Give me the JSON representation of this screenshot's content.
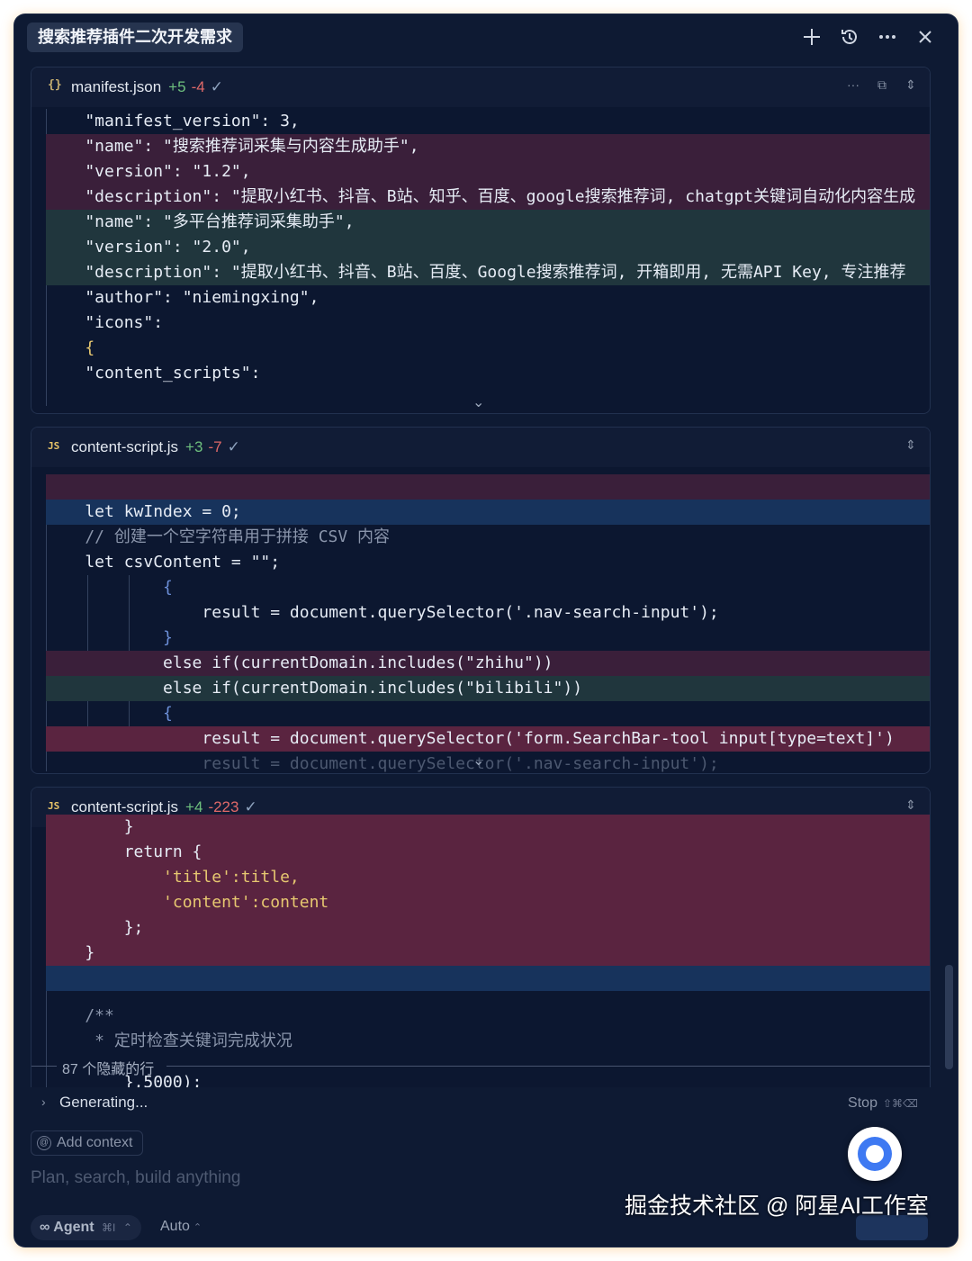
{
  "header": {
    "title": "搜索推荐插件二次开发需求",
    "icons": [
      "plus-icon",
      "history-icon",
      "more-icon",
      "close-icon"
    ]
  },
  "panels": [
    {
      "file_icon": "{}",
      "file_name": "manifest.json",
      "additions": "+5",
      "deletions": "-4",
      "check": "✓",
      "lines": [
        "    \"manifest_version\": 3,",
        "    \"name\": \"搜索推荐词采集与内容生成助手\",",
        "    \"version\": \"1.2\",",
        "    \"description\": \"提取小红书、抖音、B站、知乎、百度、google搜索推荐词, chatgpt关键词自动化内容生成",
        "    \"name\": \"多平台推荐词采集助手\",",
        "    \"version\": \"2.0\",",
        "    \"description\": \"提取小红书、抖音、B站、百度、Google搜索推荐词, 开箱即用, 无需API Key, 专注推荐",
        "    \"author\": \"niemingxing\",",
        "    \"icons\":",
        "    {",
        "    \"content_scripts\":"
      ]
    },
    {
      "file_icon": "JS",
      "file_name": "content-script.js",
      "additions": "+3",
      "deletions": "-7",
      "check": "✓",
      "lines": [
        "",
        "    let kwIndex = 0;",
        "    // 创建一个空字符串用于拼接 CSV 内容",
        "    let csvContent = \"\";",
        "            {",
        "                result = document.querySelector('.nav-search-input');",
        "            }",
        "            else if(currentDomain.includes(\"zhihu\"))",
        "            else if(currentDomain.includes(\"bilibili\"))",
        "            {",
        "                result = document.querySelector('form.SearchBar-tool input[type=text]')",
        "                result = document.querySelector('.nav-search-input');"
      ]
    },
    {
      "file_icon": "JS",
      "file_name": "content-script.js",
      "additions": "+4",
      "deletions": "-223",
      "check": "✓",
      "lines": [
        "        }",
        "        return {",
        "            'title':title,",
        "            'content':content",
        "        };",
        "    }",
        "",
        "",
        "    /**",
        "     * 定时检查关键词完成状况",
        "        },5000);"
      ],
      "hidden_lines": "87 个隐藏的行"
    }
  ],
  "footer": {
    "generating": "Generating...",
    "stop": "Stop",
    "stop_shortcut": "⇧⌘⌫",
    "add_context": "Add context",
    "placeholder": "Plan, search, build anything",
    "agent": "Agent",
    "agent_shortcut": "⌘I",
    "auto": "Auto"
  },
  "watermark": "掘金技术社区 @ 阿星AI工作室"
}
